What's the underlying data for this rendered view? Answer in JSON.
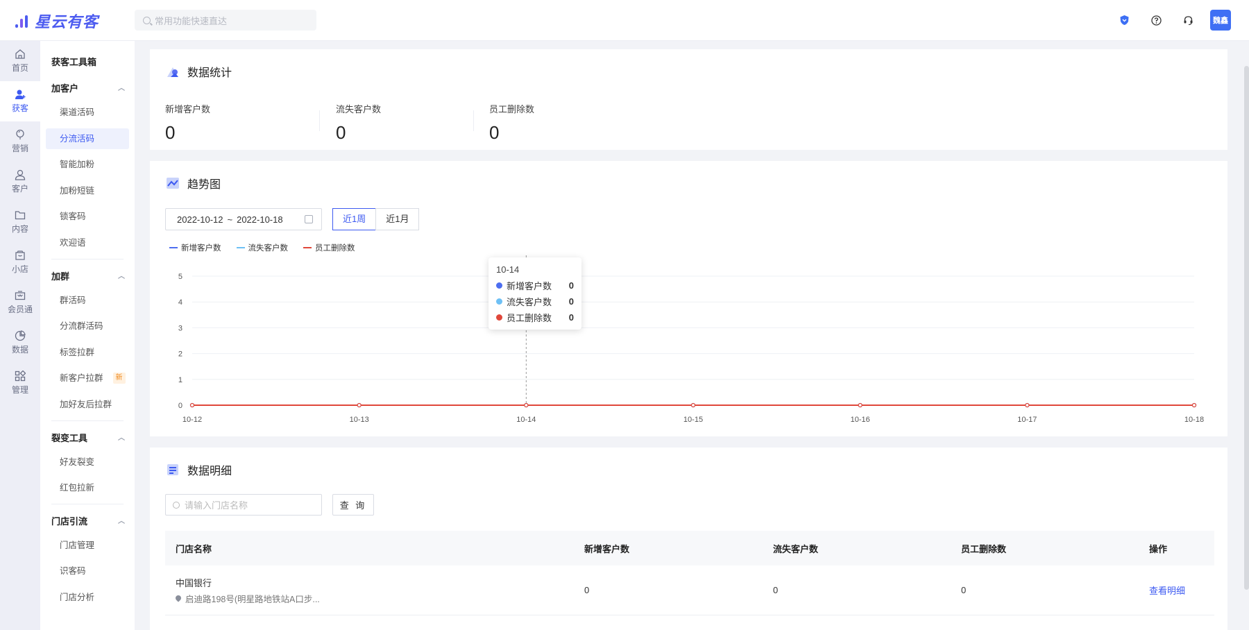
{
  "app": {
    "logo_text": "星云有客",
    "search_placeholder": "常用功能快速直达",
    "user_avatar": "魏鑫"
  },
  "rail": [
    {
      "label": "首页",
      "icon": "home-icon"
    },
    {
      "label": "获客",
      "icon": "user-add-icon",
      "active": true
    },
    {
      "label": "营销",
      "icon": "balloon-icon"
    },
    {
      "label": "客户",
      "icon": "user-icon"
    },
    {
      "label": "内容",
      "icon": "folder-icon"
    },
    {
      "label": "小店",
      "icon": "shop-icon"
    },
    {
      "label": "会员通",
      "icon": "member-icon"
    },
    {
      "label": "数据",
      "icon": "pie-icon"
    },
    {
      "label": "管理",
      "icon": "grid-icon"
    }
  ],
  "subnav": {
    "title": "获客工具箱",
    "sections": [
      {
        "title": "加客户",
        "items": [
          "渠道活码",
          "分流活码",
          "智能加粉",
          "加粉短链",
          "锁客码",
          "欢迎语"
        ]
      },
      {
        "title": "加群",
        "items": [
          "群活码",
          "分流群活码",
          "标签拉群",
          "新客户拉群",
          "加好友后拉群"
        ]
      },
      {
        "title": "裂变工具",
        "items": [
          "好友裂变",
          "红包拉新"
        ]
      },
      {
        "title": "门店引流",
        "items": [
          "门店管理",
          "识客码",
          "门店分析"
        ]
      }
    ],
    "active_item": "分流活码",
    "new_badge": "新"
  },
  "stats": {
    "title": "数据统计",
    "items": [
      {
        "label": "新增客户数",
        "value": "0"
      },
      {
        "label": "流失客户数",
        "value": "0"
      },
      {
        "label": "员工删除数",
        "value": "0"
      }
    ]
  },
  "trend": {
    "title": "趋势图",
    "date_start": "2022-10-12",
    "date_sep": "~",
    "date_end": "2022-10-18",
    "range_buttons": [
      "近1周",
      "近1月"
    ],
    "active_range": "近1周",
    "tooltip": {
      "date": "10-14",
      "rows": [
        {
          "name": "新增客户数",
          "value": "0"
        },
        {
          "name": "流失客户数",
          "value": "0"
        },
        {
          "name": "员工删除数",
          "value": "0"
        }
      ]
    }
  },
  "chart_data": {
    "type": "line",
    "x": [
      "10-12",
      "10-13",
      "10-14",
      "10-15",
      "10-16",
      "10-17",
      "10-18"
    ],
    "series": [
      {
        "name": "新增客户数",
        "values": [
          0,
          0,
          0,
          0,
          0,
          0,
          0
        ],
        "color": "#4d6ef0"
      },
      {
        "name": "流失客户数",
        "values": [
          0,
          0,
          0,
          0,
          0,
          0,
          0
        ],
        "color": "#6ec0f5"
      },
      {
        "name": "员工删除数",
        "values": [
          0,
          0,
          0,
          0,
          0,
          0,
          0
        ],
        "color": "#e0473a"
      }
    ],
    "ylim": [
      0,
      5
    ],
    "yticks": [
      0,
      1,
      2,
      3,
      4,
      5
    ],
    "grid": true,
    "legend": "top-left"
  },
  "details": {
    "title": "数据明细",
    "search_placeholder": "请输入门店名称",
    "query_label": "查 询",
    "columns": [
      "门店名称",
      "新增客户数",
      "流失客户数",
      "员工删除数",
      "操作"
    ],
    "rows": [
      {
        "name": "中国银行",
        "address": "启迪路198号(明星路地铁站A口步...",
        "new": "0",
        "lost": "0",
        "deleted": "0",
        "action": "查看明细"
      }
    ]
  },
  "colors": {
    "primary": "#3d5af1",
    "accent_new": "#f08a1e"
  }
}
